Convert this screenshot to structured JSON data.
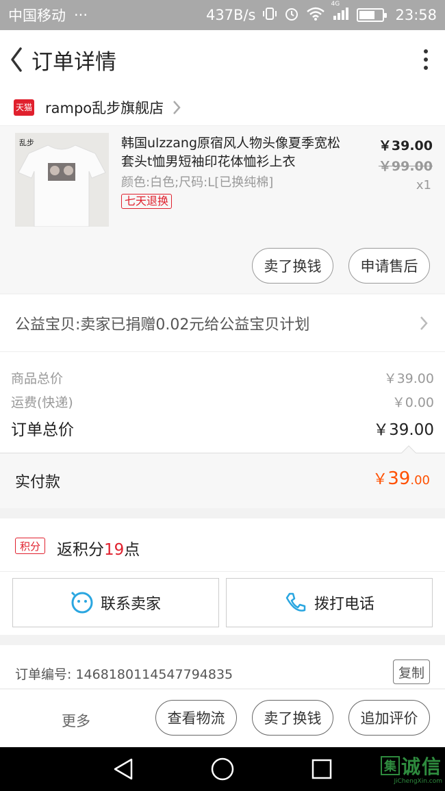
{
  "status_bar": {
    "carrier": "中国移动",
    "dots": "···",
    "speed": "437B/s",
    "net_badge": "4G",
    "time": "23:58"
  },
  "nav": {
    "title": "订单详情"
  },
  "shop": {
    "badge": "天猫",
    "name": "rampo乱步旗舰店"
  },
  "product": {
    "thumb_brand": "乱步",
    "title": "韩国ulzzang原宿风人物头像夏季宽松套头t恤男短袖印花体恤衫上衣",
    "spec": "颜色:白色;尺码:L[已换纯棉]",
    "badge": "七天退换",
    "price": "￥39.00",
    "original_price": "￥99.00",
    "quantity": "x1",
    "buttons": [
      "卖了换钱",
      "申请售后"
    ]
  },
  "charity": {
    "text": "公益宝贝:卖家已捐赠0.02元给公益宝贝计划"
  },
  "summary": {
    "goods_label": "商品总价",
    "goods_value": "￥39.00",
    "shipping_label": "运费(快递)",
    "shipping_value": "￥0.00",
    "total_label": "订单总价",
    "total_value": "￥39.00"
  },
  "paid": {
    "label": "实付款",
    "currency": "￥",
    "integer": "39",
    "decimal": ".00"
  },
  "points": {
    "tag": "积分",
    "prefix": "返积分",
    "number": "19",
    "suffix": "点"
  },
  "contact": {
    "seller": "联系卖家",
    "phone": "拨打电话"
  },
  "order": {
    "label": "订单编号:",
    "number": "1468180114547794835",
    "copy": "复制"
  },
  "actions": {
    "more": "更多",
    "buttons": [
      "查看物流",
      "卖了换钱",
      "追加评价"
    ]
  },
  "watermark": {
    "logo": "集",
    "text": "诚信",
    "url": "JiChengXin.com"
  },
  "colors": {
    "accent_red": "#e0202d",
    "price_orange": "#ff5000",
    "tmall_red": "#e0202d",
    "contact_blue": "#2aa6e0"
  }
}
